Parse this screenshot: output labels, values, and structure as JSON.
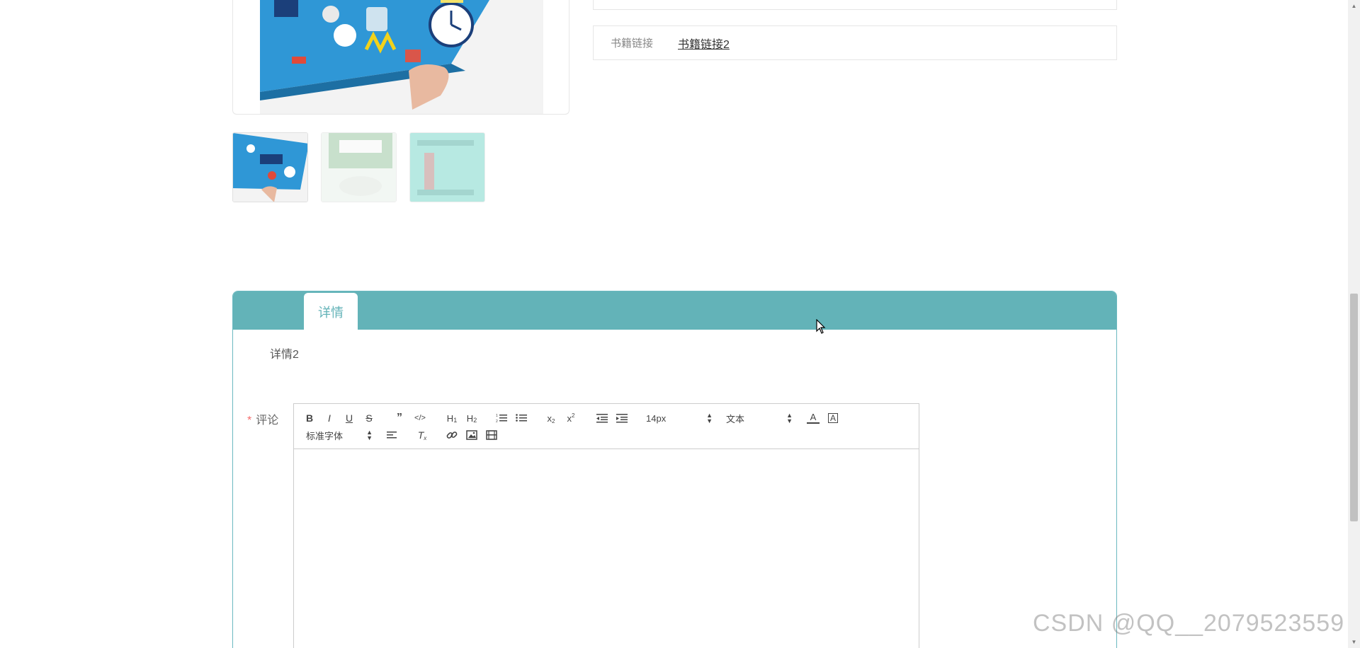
{
  "book_info": {
    "link_label": "书籍链接",
    "link_value": "书籍链接2"
  },
  "gallery": {
    "thumbnails": [
      {
        "name": "thumb-blue-cover",
        "active": true
      },
      {
        "name": "thumb-green-cover",
        "active": false
      },
      {
        "name": "thumb-magician-cover",
        "active": false
      }
    ]
  },
  "detail": {
    "tab_label": "详情",
    "content": "详情2"
  },
  "comment": {
    "required_mark": "*",
    "label": "评论",
    "font_size_value": "14px",
    "header_value": "文本",
    "font_family_value": "标准字体"
  },
  "colors": {
    "accent": "#63b3b8",
    "required": "#f56c6c"
  },
  "watermark": "CSDN @QQ__2079523559"
}
